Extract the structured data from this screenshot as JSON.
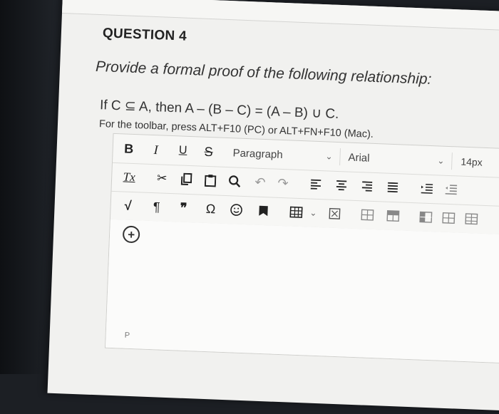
{
  "question": {
    "title": "QUESTION 4",
    "prompt": "Provide a formal proof of the following relationship:",
    "statement": "If C ⊆ A, then A – (B – C) = (A – B) ∪ C.",
    "toolbar_hint": "For the toolbar, press ALT+F10 (PC) or ALT+FN+F10 (Mac)."
  },
  "toolbar": {
    "bold": "B",
    "italic": "I",
    "underline": "U",
    "strike": "S",
    "block_format": "Paragraph",
    "font_family": "Arial",
    "font_size": "14px",
    "clear_format": "Tx",
    "pilcrow": "¶",
    "quote": "❞",
    "omega": "Ω"
  },
  "editor": {
    "status_path": "P"
  }
}
